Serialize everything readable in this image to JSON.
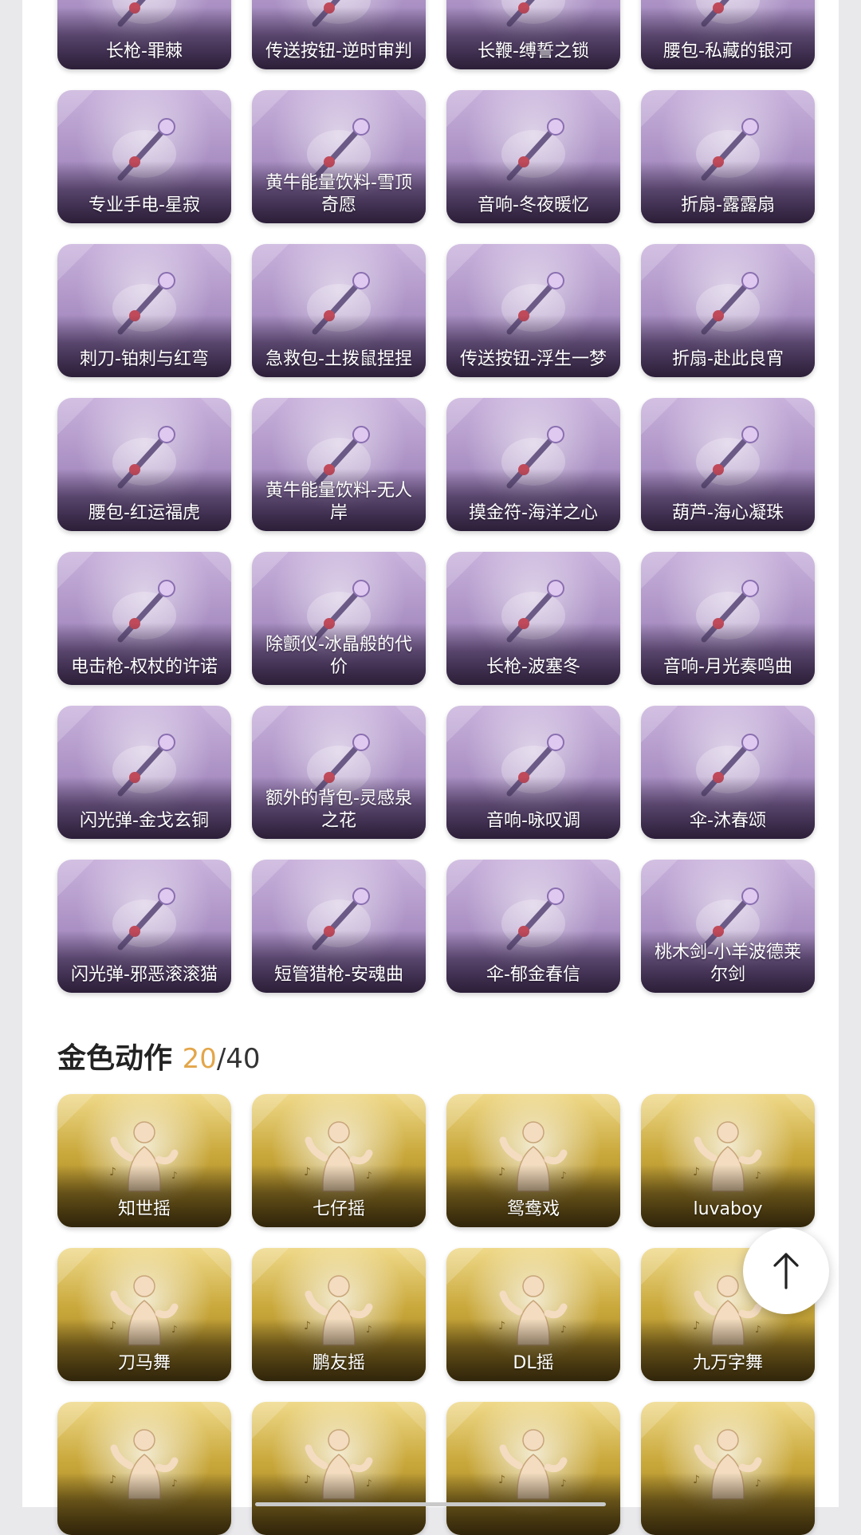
{
  "purple_items": [
    {
      "label": "长枪-罪棘",
      "icon": "spear-icon"
    },
    {
      "label": "传送按钮-逆时审判",
      "icon": "teleport-button-icon"
    },
    {
      "label": "长鞭-缚誓之锁",
      "icon": "whip-icon"
    },
    {
      "label": "腰包-私藏的银河",
      "icon": "waist-bag-icon"
    },
    {
      "label": "专业手电-星寂",
      "icon": "flashlight-icon"
    },
    {
      "label": "黄牛能量饮料-雪顶奇愿",
      "icon": "energy-drink-icon"
    },
    {
      "label": "音响-冬夜暖忆",
      "icon": "snow-globe-speaker-icon"
    },
    {
      "label": "折扇-露露扇",
      "icon": "folding-fan-icon"
    },
    {
      "label": "刺刀-铂刺与红弯",
      "icon": "bayonet-icon"
    },
    {
      "label": "急救包-土拨鼠捏捏",
      "icon": "hamster-medkit-icon"
    },
    {
      "label": "传送按钮-浮生一梦",
      "icon": "scroll-icon"
    },
    {
      "label": "折扇-赴此良宵",
      "icon": "folding-fan-icon"
    },
    {
      "label": "腰包-红运福虎",
      "icon": "tiger-bag-icon"
    },
    {
      "label": "黄牛能量饮料-无人岸",
      "icon": "potion-icon"
    },
    {
      "label": "摸金符-海洋之心",
      "icon": "pendant-icon"
    },
    {
      "label": "葫芦-海心凝珠",
      "icon": "seashell-pearl-icon"
    },
    {
      "label": "电击枪-权杖的许诺",
      "icon": "scepter-icon"
    },
    {
      "label": "除颤仪-冰晶般的代价",
      "icon": "crystal-lotus-icon"
    },
    {
      "label": "长枪-波塞冬",
      "icon": "trident-icon"
    },
    {
      "label": "音响-月光奏鸣曲",
      "icon": "piano-speaker-icon"
    },
    {
      "label": "闪光弹-金戈玄铜",
      "icon": "grenade-icon"
    },
    {
      "label": "额外的背包-灵感泉之花",
      "icon": "flower-bouquet-icon"
    },
    {
      "label": "音响-咏叹调",
      "icon": "birdcage-icon"
    },
    {
      "label": "伞-沐春颂",
      "icon": "flower-umbrella-icon"
    },
    {
      "label": "闪光弹-邪恶滚滚猫",
      "icon": "cat-grenade-icon"
    },
    {
      "label": "短管猎枪-安魂曲",
      "icon": "shotgun-icon"
    },
    {
      "label": "伞-郁金春信",
      "icon": "paper-umbrella-icon"
    },
    {
      "label": "桃木剑-小羊波德莱尔剑",
      "icon": "sword-icon"
    }
  ],
  "gold_section": {
    "title": "金色动作",
    "count_current": "20",
    "count_separator": "/",
    "count_total": "40"
  },
  "gold_items": [
    {
      "label": "知世摇",
      "icon": "dance-pose-icon"
    },
    {
      "label": "七仔摇",
      "icon": "dance-pose-icon"
    },
    {
      "label": "鸳鸯戏",
      "icon": "dance-pose-icon"
    },
    {
      "label": "luvaboy",
      "icon": "dance-pose-icon"
    },
    {
      "label": "刀马舞",
      "icon": "dance-pose-icon"
    },
    {
      "label": "鹏友摇",
      "icon": "dance-pose-icon"
    },
    {
      "label": "DL摇",
      "icon": "dance-pose-icon"
    },
    {
      "label": "九万字舞",
      "icon": "dance-pose-icon"
    },
    {
      "label": "",
      "icon": "heart-pose-icon"
    },
    {
      "label": "",
      "icon": "dance-pose-icon"
    },
    {
      "label": "",
      "icon": "dance-pose-icon"
    },
    {
      "label": "",
      "icon": "dance-pose-icon"
    }
  ],
  "colors": {
    "purple_card": "#a88ec2",
    "gold_card": "#c9a83b",
    "count_accent": "#e3a64a"
  },
  "back_to_top": {
    "icon": "arrow-up-icon"
  }
}
